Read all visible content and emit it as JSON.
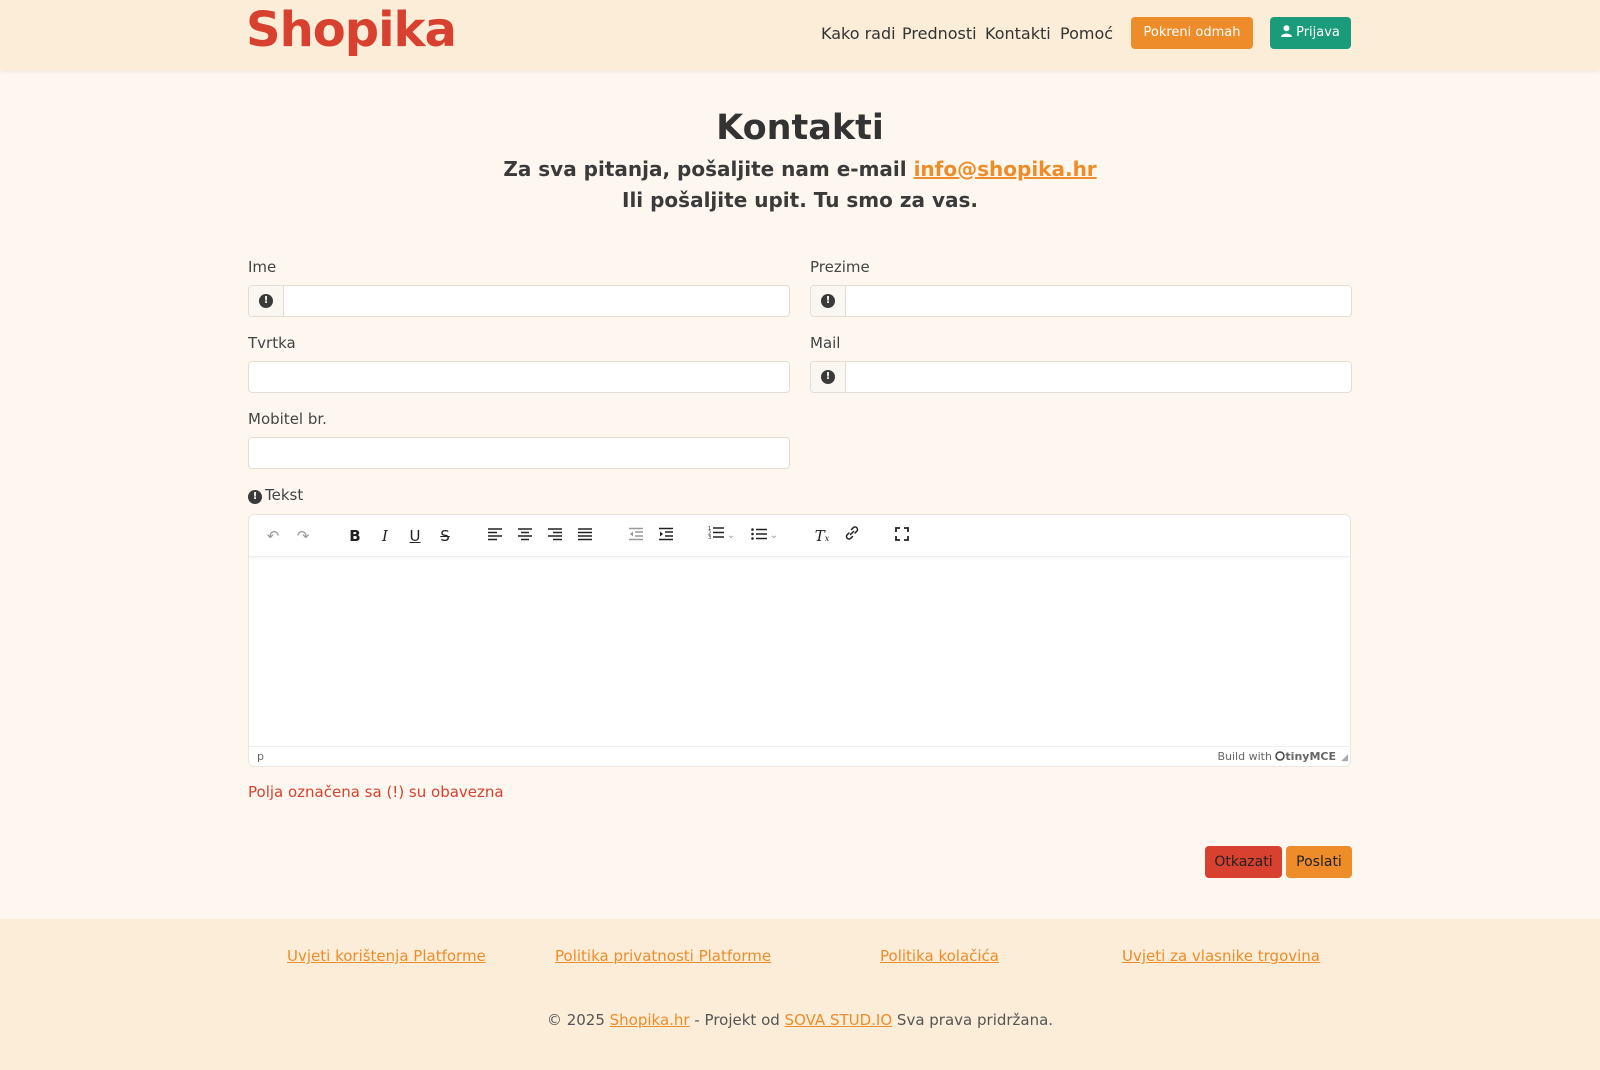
{
  "header": {
    "logo": "Shopika",
    "nav": [
      "Kako radi",
      "Prednosti",
      "Kontakti",
      "Pomoć"
    ],
    "start_button": "Pokreni odmah",
    "login_button": "Prijava"
  },
  "intro": {
    "title": "Kontakti",
    "line1_prefix": "Za sva pitanja, pošaljite nam e-mail ",
    "email": "info@shopika.hr",
    "line2": "Ili pošaljite upit. Tu smo za vas."
  },
  "form": {
    "first_name_label": "Ime",
    "last_name_label": "Prezime",
    "company_label": "Tvrtka",
    "mail_label": "Mail",
    "mobile_label": "Mobitel br.",
    "text_label": "Tekst",
    "required_icon": "!",
    "values": {
      "first_name": "",
      "last_name": "",
      "company": "",
      "mail": "",
      "mobile": ""
    }
  },
  "editor": {
    "toolbar_icons": [
      "undo-icon",
      "redo-icon",
      "bold-icon",
      "italic-icon",
      "underline-icon",
      "strikethrough-icon",
      "align-left-icon",
      "align-center-icon",
      "align-right-icon",
      "align-justify-icon",
      "outdent-icon",
      "indent-icon",
      "numbered-list-icon",
      "bullet-list-icon",
      "clear-formatting-icon",
      "link-icon",
      "fullscreen-icon"
    ],
    "status_path": "p",
    "branding_prefix": "Build with",
    "branding_name": "tinyMCE"
  },
  "required_note": "Polja označena sa (!) su obavezna",
  "actions": {
    "cancel": "Otkazati",
    "send": "Poslati"
  },
  "footer": {
    "links": [
      "Uvjeti korištenja Platforme",
      "Politika privatnosti Platforme",
      "Politika kolačića",
      "Uvjeti za vlasnike trgovina"
    ],
    "copyright_prefix": "© 2025 ",
    "site_link": "Shopika.hr",
    "project_text": " - Projekt od ",
    "studio_link": "SOVA STUD.IO",
    "rights_text": " Sva prava pridržana."
  },
  "colors": {
    "brand_red": "#d8412f",
    "accent_orange": "#ef8c2a",
    "login_green": "#1a9c7a",
    "header_bg": "#fbedd8",
    "page_bg": "#fdf7ef"
  }
}
